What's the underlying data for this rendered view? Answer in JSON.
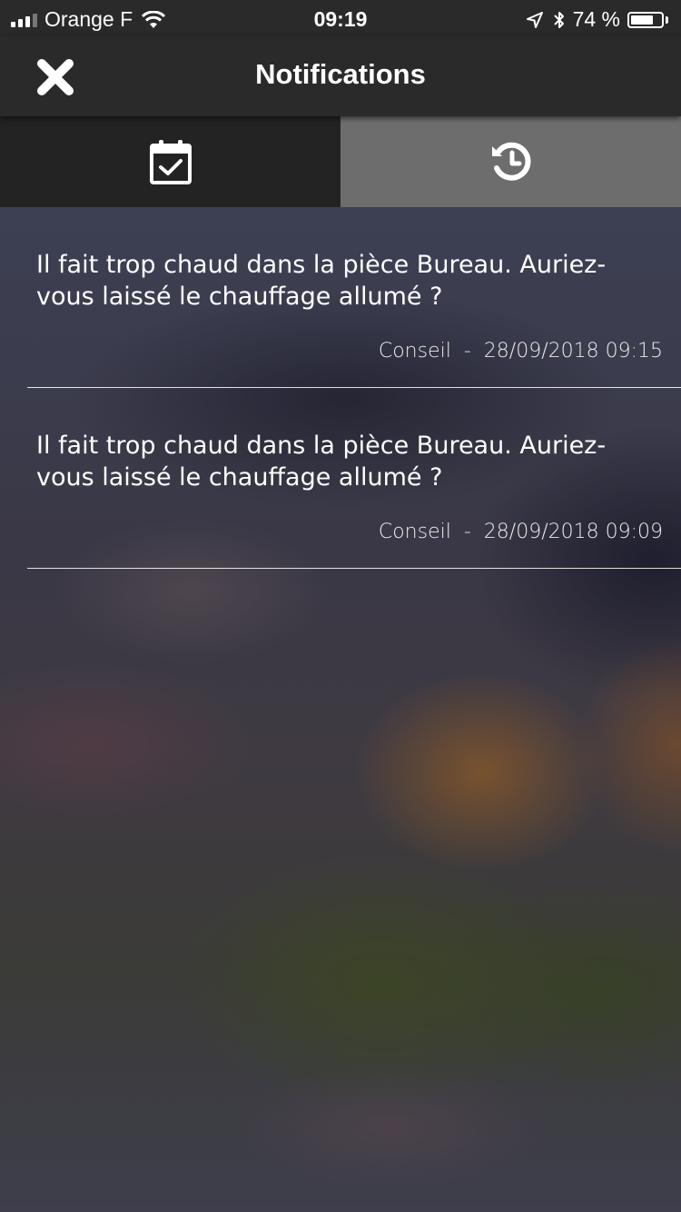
{
  "status_bar": {
    "carrier": "Orange F",
    "time": "09:19",
    "battery_percent": "74 %",
    "battery_level": 0.74,
    "icons": [
      "signal-bars-icon",
      "wifi-icon",
      "location-arrow-icon",
      "bluetooth-icon",
      "battery-icon"
    ]
  },
  "header": {
    "title": "Notifications",
    "close_icon": "close-x-icon"
  },
  "tabs": [
    {
      "icon": "calendar-check-icon",
      "selected": true
    },
    {
      "icon": "history-clock-icon",
      "selected": false
    }
  ],
  "notifications": [
    {
      "message": "Il fait trop chaud dans la pièce Bureau. Auriez-vous laissé le chauffage allumé ?",
      "category": "Conseil",
      "separator": "-",
      "datetime": "28/09/2018 09:15"
    },
    {
      "message": "Il fait trop chaud dans la pièce Bureau. Auriez-vous laissé le chauffage allumé ?",
      "category": "Conseil",
      "separator": "-",
      "datetime": "28/09/2018 09:09"
    }
  ],
  "colors": {
    "bar_bg": "#2a2a2a",
    "tab_selected_bg": "#232323",
    "tab_unselected_bg": "#6d6d6d",
    "text": "#ffffff"
  }
}
